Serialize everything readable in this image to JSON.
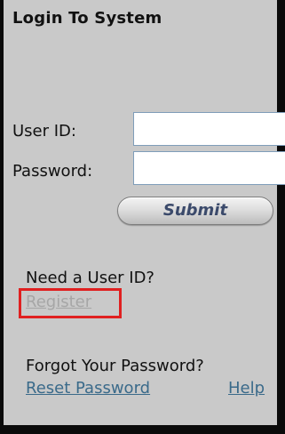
{
  "login": {
    "title": "Login To System",
    "user_id_label": "User ID:",
    "user_id_value": "",
    "password_label": "Password:",
    "password_value": "",
    "submit_label": "Submit"
  },
  "register": {
    "prompt": "Need a User ID?",
    "link_label": "Register"
  },
  "forgot": {
    "prompt": "Forgot Your Password?",
    "reset_label": "Reset Password",
    "help_label": "Help"
  },
  "colors": {
    "panel_background": "#c9c9c9",
    "border": "#0a0a0a",
    "link": "#3a6a8a",
    "disabled_link": "#a6a6a6",
    "highlight_box": "#e02020"
  }
}
